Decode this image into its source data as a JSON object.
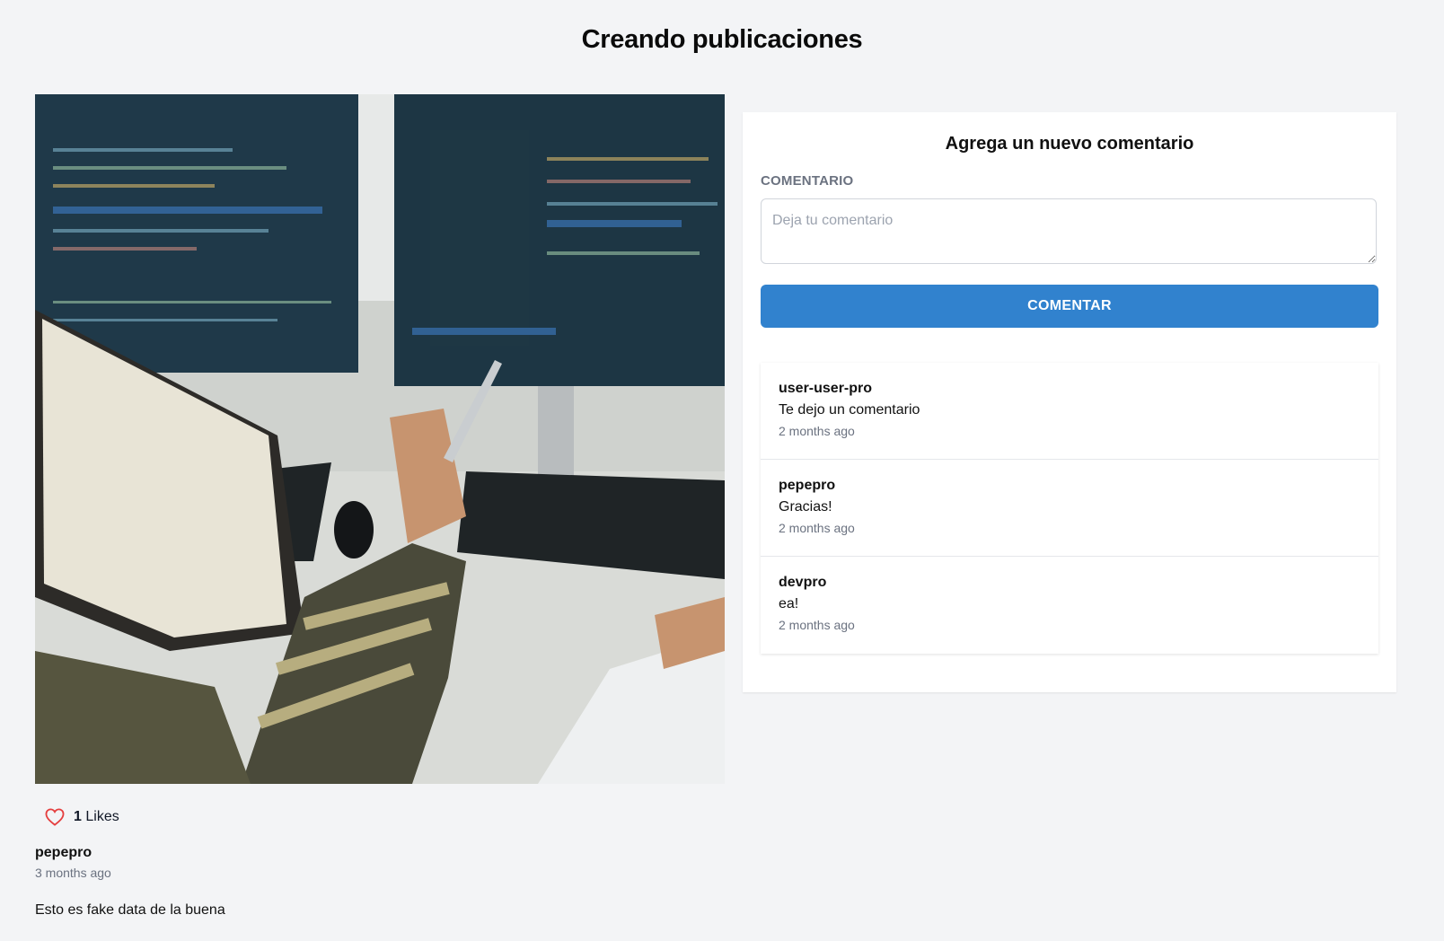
{
  "page": {
    "title": "Creando publicaciones"
  },
  "post": {
    "image": "photo-developers-at-computer",
    "likes_count": "1",
    "likes_label": "Likes",
    "author": "pepepro",
    "time": "3 months ago",
    "body": "Esto es fake data de la buena"
  },
  "comments_panel": {
    "title": "Agrega un nuevo comentario",
    "field_label": "COMENTARIO",
    "placeholder": "Deja tu comentario",
    "value": "",
    "submit_label": "COMENTAR",
    "items": [
      {
        "user": "user-user-pro",
        "text": "Te dejo un comentario",
        "time": "2 months ago"
      },
      {
        "user": "pepepro",
        "text": "Gracias!",
        "time": "2 months ago"
      },
      {
        "user": "devpro",
        "text": "ea!",
        "time": "2 months ago"
      }
    ]
  },
  "colors": {
    "background": "#f3f4f6",
    "accent": "#3182ce",
    "heart": "#e53e3e",
    "muted_text": "#6b7280"
  },
  "icons": {
    "like": "heart-outline-icon",
    "resize": "resize-grip-icon"
  }
}
